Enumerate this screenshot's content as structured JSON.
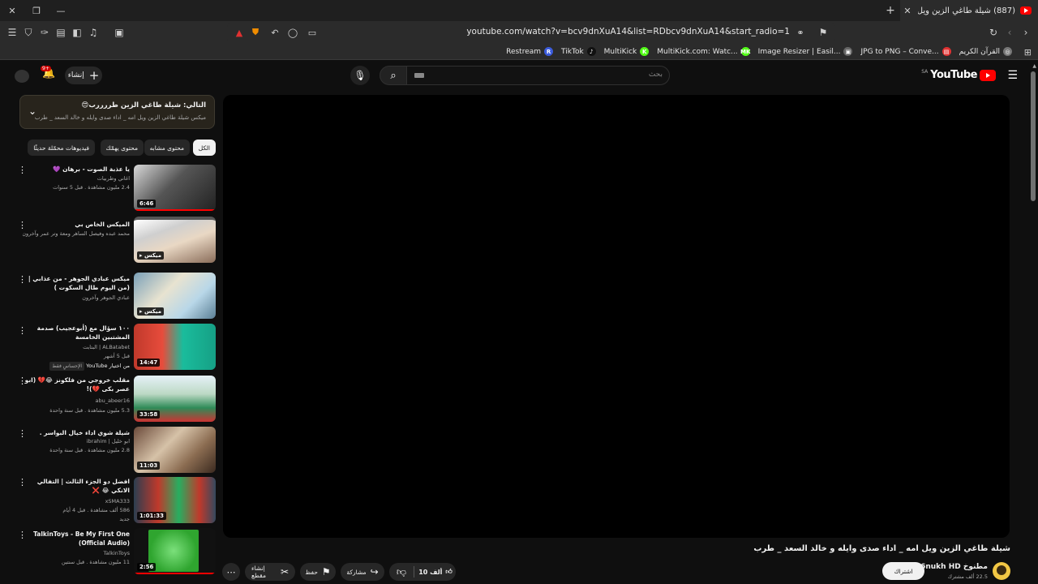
{
  "browser": {
    "tab_title": "(887) شيلة طاغي الزين ويل امه _",
    "url": "youtube.com/watch?v=bcv9dnXuA14&list=RDbcv9dnXuA14&start_radio=1",
    "bookmarks": [
      {
        "label": "Restream",
        "icon": "R",
        "color": "#3b5bdb"
      },
      {
        "label": "TikTok",
        "icon": "♪",
        "color": "#111111"
      },
      {
        "label": "MultiKick",
        "icon": "K",
        "color": "#53fc18"
      },
      {
        "label": "MultiKick.com: Watc...",
        "icon": "MK",
        "color": "#53fc18"
      },
      {
        "label": "Image Resizer | Easil...",
        "icon": "▣",
        "color": "#666666"
      },
      {
        "label": "JPG to PNG – Conve...",
        "icon": "▤",
        "color": "#e03131"
      },
      {
        "label": "القرآن الكريم",
        "icon": "◎",
        "color": "#777777"
      }
    ]
  },
  "header": {
    "logo_text": "YouTube",
    "logo_country": "SA",
    "search_placeholder": "بحث",
    "create_label": "إنشاء",
    "notif_count": "9+"
  },
  "next_panel": {
    "title": "التالي: شيلة طاغي الزين طررررب😍",
    "subtitle": "ميكس شيلة طاغي الزين ويل امه _ اداء صدى وايله و خالد السعد _ طرب"
  },
  "chips": [
    "الكل",
    "محتوى مشابه",
    "محتوى يهمّك",
    "فيديوهات محمّلة حديثًا"
  ],
  "recommendations": [
    {
      "title": "يا عذبة الصوت - برهان 💜",
      "channel": "اغاني وطربيات",
      "meta": "2.4 مليون مشاهدة . قبل 5 سنوات",
      "duration": "6:46"
    },
    {
      "title": "الميكس الخاص بي",
      "channel": "محمد عبده وفيصل الساهر ومعة وتر عمر وآخرون",
      "meta": "",
      "duration": "ميكس"
    },
    {
      "title": "ميكس عبادي الجوهر - من عذابي | (من اليوم طال السكوت )",
      "channel": "عبادي الجوهر وآخرون",
      "meta": "",
      "duration": "ميكس"
    },
    {
      "title": "١٠٠ سؤال مع (أبوعجيب) صدمة المشتبين الخامسة",
      "channel": "ALBatabet | البتابت",
      "meta": "قبل 5 أشهر",
      "extra": "من اختيار YouTube",
      "badge": "الإحساسِ فقط",
      "duration": "14:47"
    },
    {
      "title": "مقلب خروجي من فلكونز 😂💔 (ابو عصر بكى 💔)!",
      "channel": "abu_abeer16",
      "meta": "5.3 مليون مشاهدة . قبل سنة واحدة",
      "duration": "33:58"
    },
    {
      "title": "شيلة شوي اداء خيال البواسر .",
      "channel": "ابو خليل | ibrahim",
      "meta": "2.8 مليون مشاهدة . قبل سنة واحدة",
      "duration": "11:03"
    },
    {
      "title": "افضل دو الجزء الثالث | التفالي الانكي 😂 ❌",
      "channel": "xSMA333",
      "meta": "586 ألف مشاهدة . قبل 4 أيام",
      "extra": "جديد",
      "duration": "1:01:33"
    },
    {
      "title": "TalkinToys - Be My First One (Official Audio)",
      "channel": "TalkinToys",
      "meta": "11 مليون مشاهدة . قبل سنتين",
      "duration": "2:56"
    }
  ],
  "video": {
    "title": "شيلة طاغي الزين ويل امه _ اداء صدى وايله و خالد السعد _ طرب",
    "channel": "M6nukh HD",
    "channel_label": "مطنوخ",
    "subscribers": "22.5 ألف مشترك",
    "subscribe_label": "اشتراك",
    "like_count": "10 ألف",
    "share_label": "مشاركة",
    "save_label": "حفظ",
    "clip_label": "إنشاء مقطع"
  },
  "colors": {
    "accent": "#ff0000",
    "bg": "#0f0f0f",
    "chip": "#272727"
  }
}
